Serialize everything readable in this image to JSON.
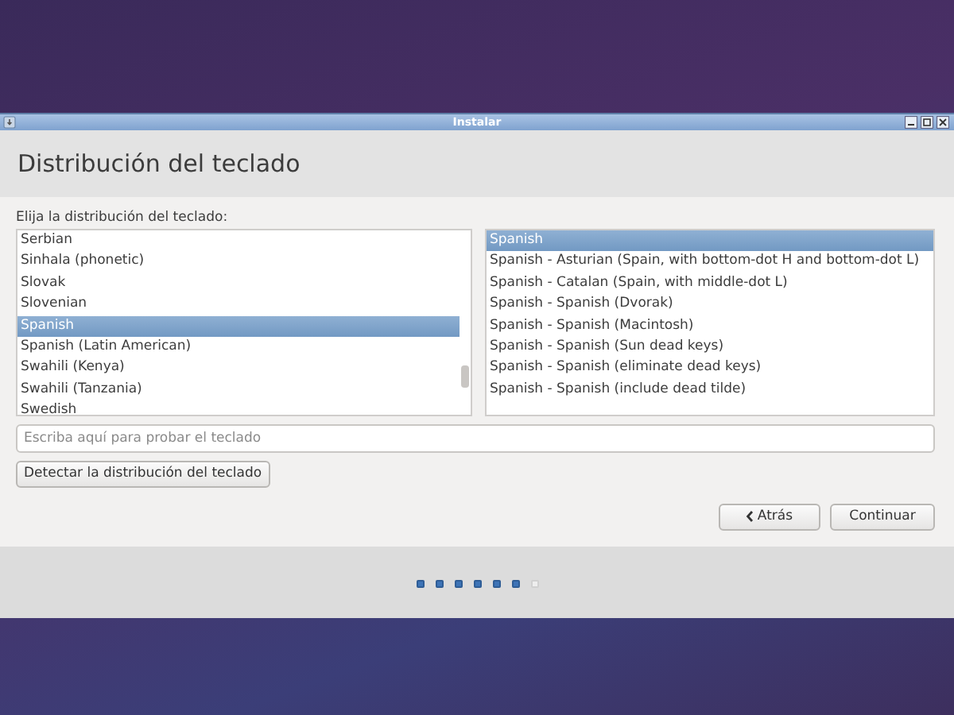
{
  "window": {
    "title": "Instalar"
  },
  "header": {
    "title": "Distribución del teclado"
  },
  "prompt": "Elija la distribución del teclado:",
  "layouts": [
    {
      "label": "Serbian",
      "selected": false
    },
    {
      "label": "Sinhala (phonetic)",
      "selected": false
    },
    {
      "label": "Slovak",
      "selected": false
    },
    {
      "label": "Slovenian",
      "selected": false
    },
    {
      "label": "Spanish",
      "selected": true
    },
    {
      "label": "Spanish (Latin American)",
      "selected": false
    },
    {
      "label": "Swahili (Kenya)",
      "selected": false
    },
    {
      "label": "Swahili (Tanzania)",
      "selected": false
    },
    {
      "label": "Swedish",
      "selected": false
    }
  ],
  "variants": [
    {
      "label": "Spanish",
      "selected": true
    },
    {
      "label": "Spanish - Asturian (Spain, with bottom-dot H and bottom-dot L)",
      "selected": false
    },
    {
      "label": "Spanish - Catalan (Spain, with middle-dot L)",
      "selected": false
    },
    {
      "label": "Spanish - Spanish (Dvorak)",
      "selected": false
    },
    {
      "label": "Spanish - Spanish (Macintosh)",
      "selected": false
    },
    {
      "label": "Spanish - Spanish (Sun dead keys)",
      "selected": false
    },
    {
      "label": "Spanish - Spanish (eliminate dead keys)",
      "selected": false
    },
    {
      "label": "Spanish - Spanish (include dead tilde)",
      "selected": false
    }
  ],
  "test_field": {
    "placeholder": "Escriba aquí para probar el teclado"
  },
  "detect_button": "Detectar la distribución del teclado",
  "buttons": {
    "back": "Atrás",
    "continue": "Continuar"
  },
  "steps": [
    {
      "done": true
    },
    {
      "done": true
    },
    {
      "done": true
    },
    {
      "done": true
    },
    {
      "done": true
    },
    {
      "done": true
    },
    {
      "done": false
    }
  ]
}
